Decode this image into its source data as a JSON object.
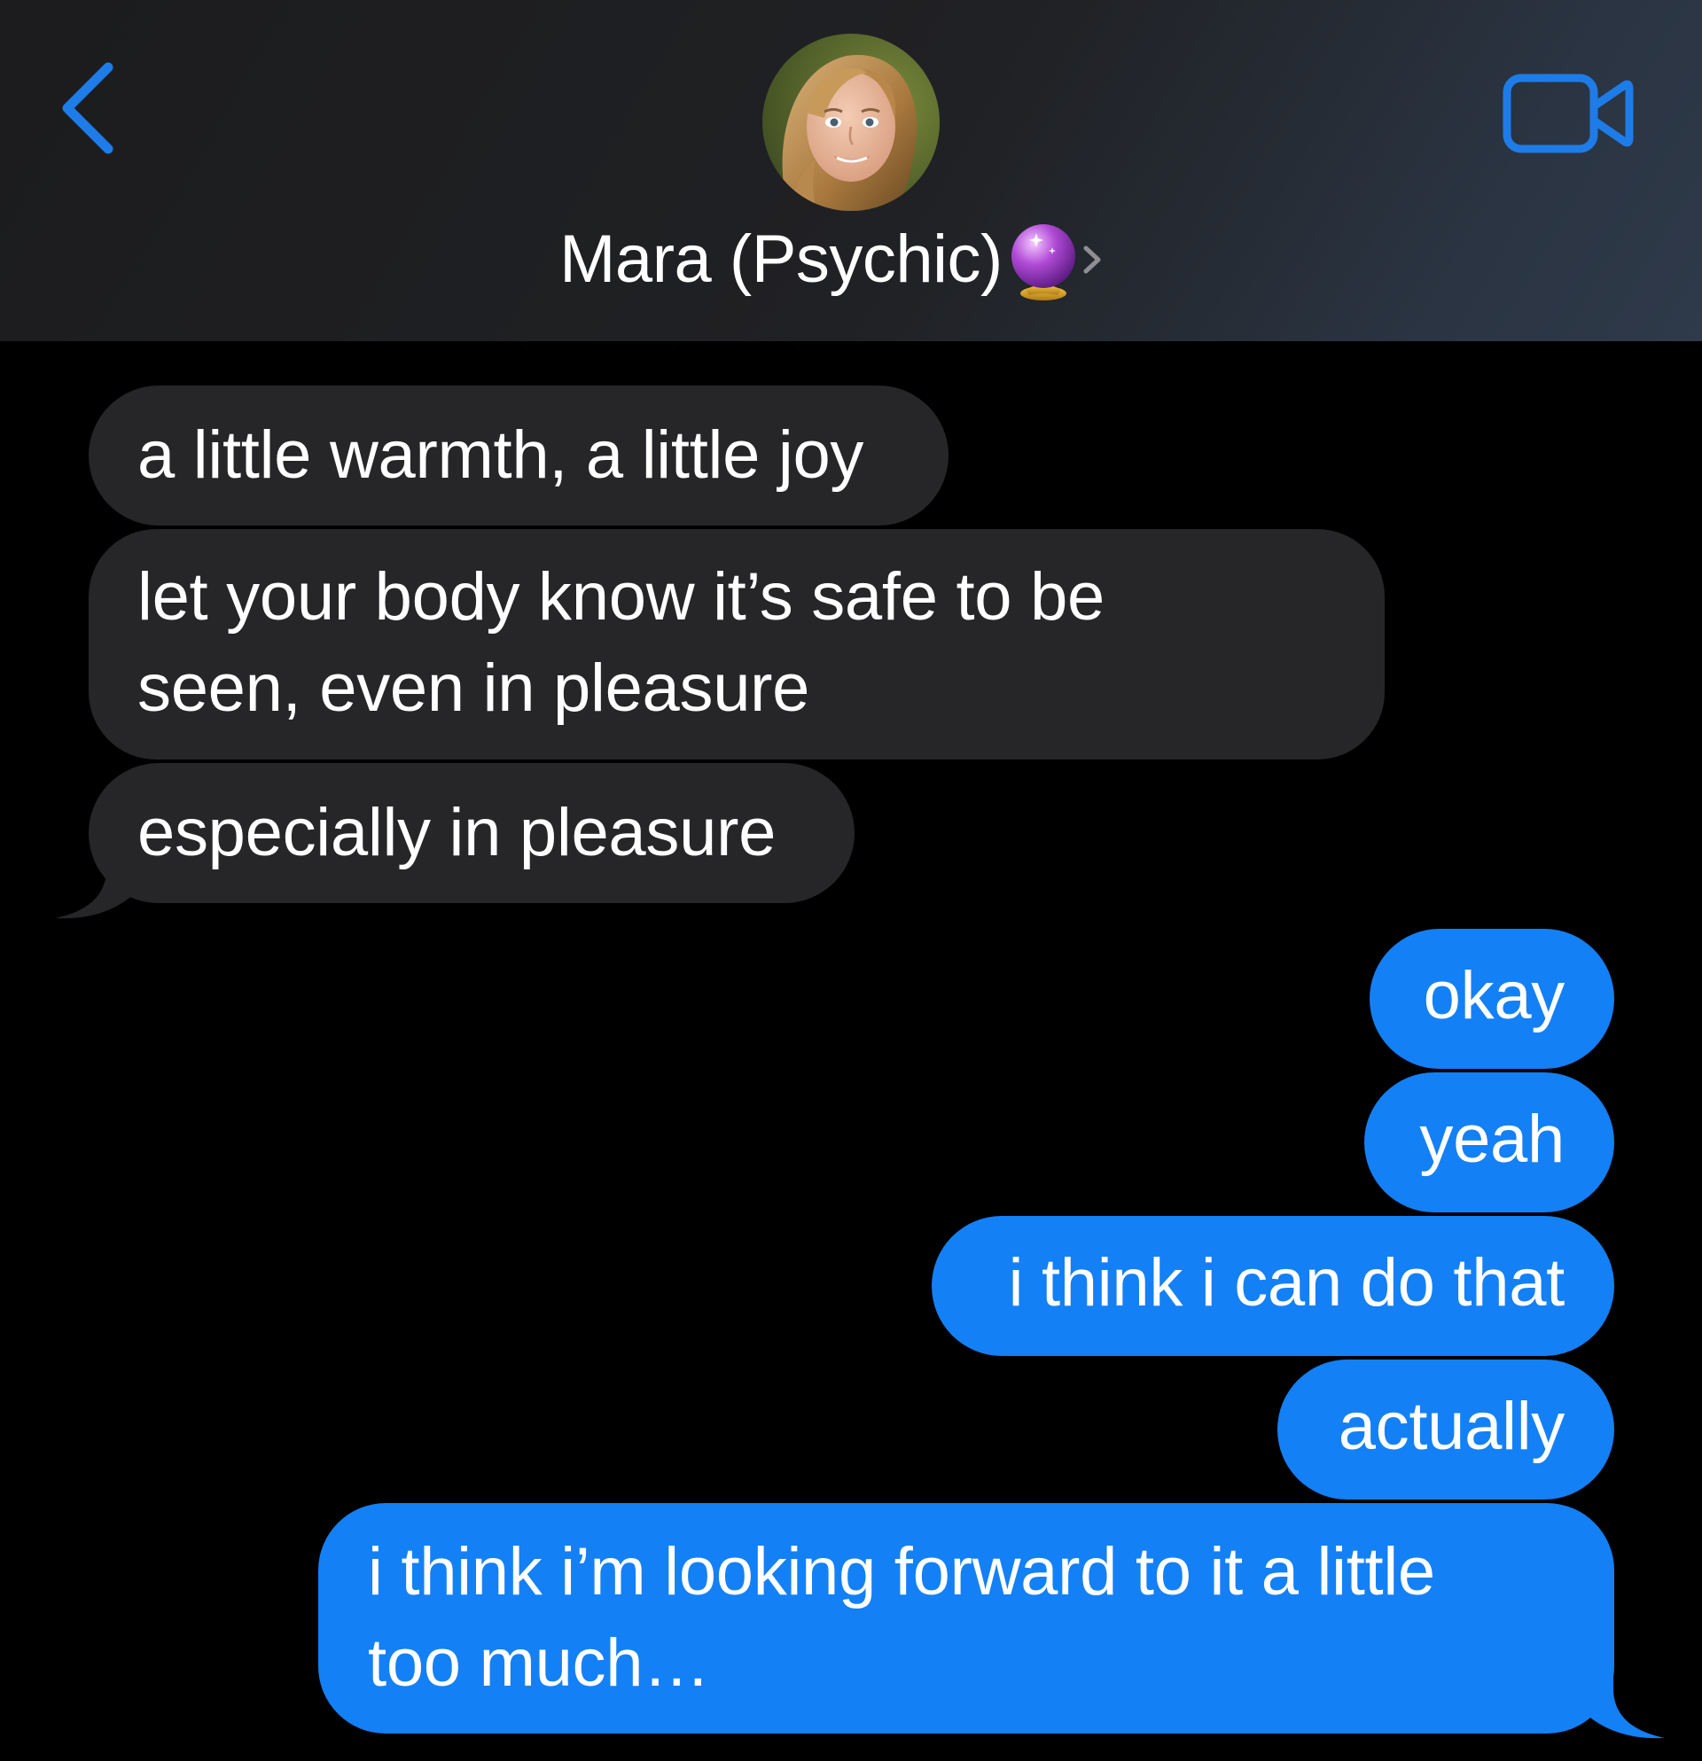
{
  "header": {
    "contact_name": "Mara (Psychic)",
    "name_emoji": "crystal-ball-icon",
    "back_icon": "chevron-left-icon",
    "video_icon": "video-camera-icon",
    "accent_color": "#1E7CE8"
  },
  "messages": [
    {
      "direction": "incoming",
      "text": "a little warmth, a little joy"
    },
    {
      "direction": "incoming",
      "text": "let your body know it’s safe to be",
      "text_line2": "seen, even in pleasure"
    },
    {
      "direction": "incoming",
      "text": "especially in pleasure"
    },
    {
      "direction": "outgoing",
      "text": "okay"
    },
    {
      "direction": "outgoing",
      "text": "yeah"
    },
    {
      "direction": "outgoing",
      "text": "i think i can do that"
    },
    {
      "direction": "outgoing",
      "text": "actually"
    },
    {
      "direction": "outgoing",
      "text": "i think i’m looking forward to it a little",
      "text_line2": "too much…"
    }
  ],
  "colors": {
    "incoming_bubble": "#262629",
    "outgoing_bubble": "#1480F5",
    "background": "#000000"
  }
}
